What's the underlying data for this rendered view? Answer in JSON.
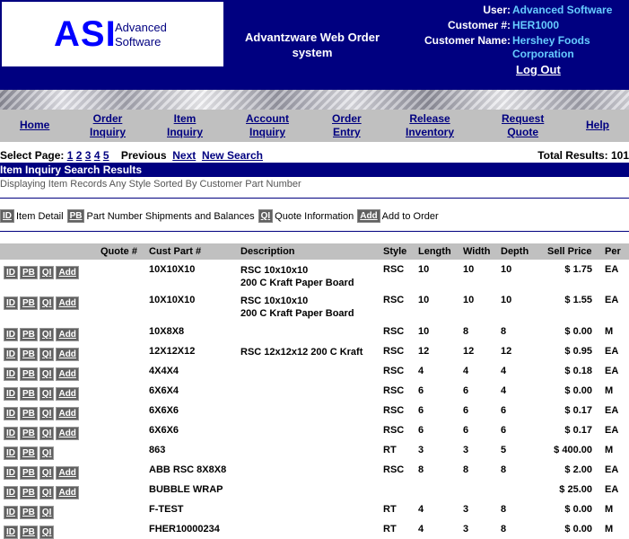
{
  "header": {
    "logo_letters": "ASI",
    "logo_line1": "Advanced",
    "logo_line2": "Software",
    "app_title": "Advantzware Web Order system",
    "user_label": "User:",
    "user_value": "Advanced Software",
    "customer_no_label": "Customer #:",
    "customer_no_value": "HER1000",
    "customer_name_label": "Customer Name:",
    "customer_name_line1": "Hershey Foods",
    "customer_name_line2": "Corporation",
    "logout": "Log Out"
  },
  "nav": [
    {
      "l1": "Home",
      "l2": ""
    },
    {
      "l1": "Order",
      "l2": "Inquiry"
    },
    {
      "l1": "Item",
      "l2": "Inquiry"
    },
    {
      "l1": "Account",
      "l2": "Inquiry"
    },
    {
      "l1": "Order",
      "l2": "Entry"
    },
    {
      "l1": "Release",
      "l2": "Inventory"
    },
    {
      "l1": "Request",
      "l2": "Quote"
    },
    {
      "l1": "Help",
      "l2": ""
    }
  ],
  "paging": {
    "label": "Select Page:",
    "pages": [
      "1",
      "2",
      "3",
      "4",
      "5"
    ],
    "previous": "Previous",
    "next": "Next",
    "new_search": "New Search",
    "total": "Total Results: 101"
  },
  "results_title": "Item Inquiry Search Results",
  "results_desc": "Displaying Item Records Any Style Sorted By Customer Part Number",
  "legend": [
    {
      "tag": "ID",
      "text": "Item Detail"
    },
    {
      "tag": "PB",
      "text": "Part Number Shipments and Balances"
    },
    {
      "tag": "QI",
      "text": "Quote Information"
    },
    {
      "tag": "Add",
      "text": "Add to Order"
    }
  ],
  "columns": [
    "Quote #",
    "Cust Part #",
    "Description",
    "Style",
    "Length",
    "Width",
    "Depth",
    "Sell Price",
    "Per"
  ],
  "rows": [
    {
      "btns": [
        "ID",
        "PB",
        "QI",
        "Add"
      ],
      "quote": "",
      "part": "10X10X10",
      "desc1": "RSC 10x10x10",
      "desc2": "200 C Kraft Paper Board",
      "style": "RSC",
      "length": "10",
      "width": "10",
      "depth": "10",
      "price": "$ 1.75",
      "per": "EA"
    },
    {
      "btns": [
        "ID",
        "PB",
        "QI",
        "Add"
      ],
      "quote": "",
      "part": "10X10X10",
      "desc1": "RSC 10x10x10",
      "desc2": "200 C Kraft Paper Board",
      "style": "RSC",
      "length": "10",
      "width": "10",
      "depth": "10",
      "price": "$ 1.55",
      "per": "EA"
    },
    {
      "btns": [
        "ID",
        "PB",
        "QI",
        "Add"
      ],
      "quote": "",
      "part": "10X8X8",
      "desc1": "",
      "desc2": "",
      "style": "RSC",
      "length": "10",
      "width": "8",
      "depth": "8",
      "price": "$ 0.00",
      "per": "M"
    },
    {
      "btns": [
        "ID",
        "PB",
        "QI",
        "Add"
      ],
      "quote": "",
      "part": "12X12X12",
      "desc1": "RSC 12x12x12 200 C Kraft",
      "desc2": "",
      "style": "RSC",
      "length": "12",
      "width": "12",
      "depth": "12",
      "price": "$ 0.95",
      "per": "EA"
    },
    {
      "btns": [
        "ID",
        "PB",
        "QI",
        "Add"
      ],
      "quote": "",
      "part": "4X4X4",
      "desc1": "",
      "desc2": "",
      "style": "RSC",
      "length": "4",
      "width": "4",
      "depth": "4",
      "price": "$ 0.18",
      "per": "EA"
    },
    {
      "btns": [
        "ID",
        "PB",
        "QI",
        "Add"
      ],
      "quote": "",
      "part": "6X6X4",
      "desc1": "",
      "desc2": "",
      "style": "RSC",
      "length": "6",
      "width": "6",
      "depth": "4",
      "price": "$ 0.00",
      "per": "M"
    },
    {
      "btns": [
        "ID",
        "PB",
        "QI",
        "Add"
      ],
      "quote": "",
      "part": "6X6X6",
      "desc1": "",
      "desc2": "",
      "style": "RSC",
      "length": "6",
      "width": "6",
      "depth": "6",
      "price": "$ 0.17",
      "per": "EA"
    },
    {
      "btns": [
        "ID",
        "PB",
        "QI",
        "Add"
      ],
      "quote": "",
      "part": "6X6X6",
      "desc1": "",
      "desc2": "",
      "style": "RSC",
      "length": "6",
      "width": "6",
      "depth": "6",
      "price": "$ 0.17",
      "per": "EA"
    },
    {
      "btns": [
        "ID",
        "PB",
        "QI"
      ],
      "quote": "",
      "part": "863",
      "desc1": "",
      "desc2": "",
      "style": "RT",
      "length": "3",
      "width": "3",
      "depth": "5",
      "price": "$ 400.00",
      "per": "M"
    },
    {
      "btns": [
        "ID",
        "PB",
        "QI",
        "Add"
      ],
      "quote": "",
      "part": "ABB RSC 8X8X8",
      "desc1": "",
      "desc2": "",
      "style": "RSC",
      "length": "8",
      "width": "8",
      "depth": "8",
      "price": "$ 2.00",
      "per": "EA"
    },
    {
      "btns": [
        "ID",
        "PB",
        "QI",
        "Add"
      ],
      "quote": "",
      "part": "BUBBLE WRAP",
      "desc1": "",
      "desc2": "",
      "style": "",
      "length": "",
      "width": "",
      "depth": "",
      "price": "$ 25.00",
      "per": "EA"
    },
    {
      "btns": [
        "ID",
        "PB",
        "QI"
      ],
      "quote": "",
      "part": "F-TEST",
      "desc1": "",
      "desc2": "",
      "style": "RT",
      "length": "4",
      "width": "3",
      "depth": "8",
      "price": "$ 0.00",
      "per": "M"
    },
    {
      "btns": [
        "ID",
        "PB",
        "QI"
      ],
      "quote": "",
      "part": "FHER10000234",
      "desc1": "",
      "desc2": "",
      "style": "RT",
      "length": "4",
      "width": "3",
      "depth": "8",
      "price": "$ 0.00",
      "per": "M"
    }
  ]
}
